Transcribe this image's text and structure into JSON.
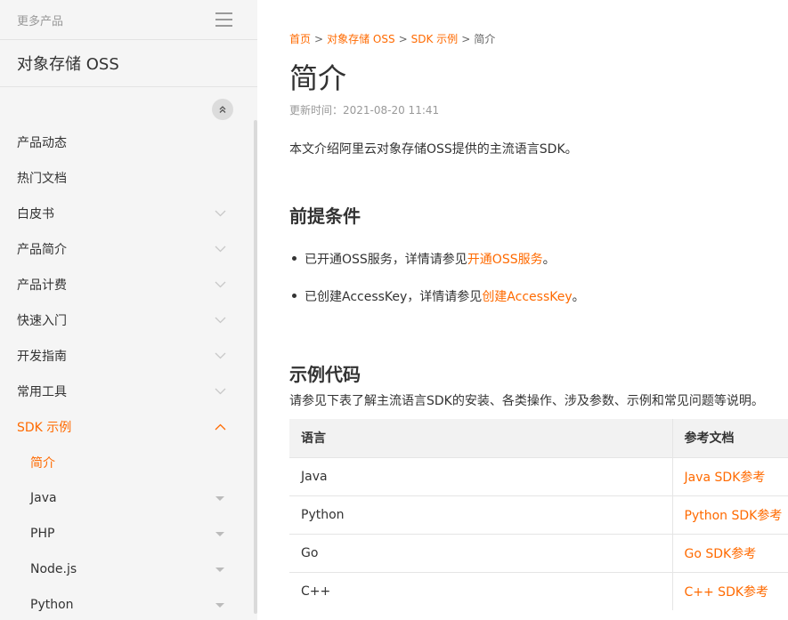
{
  "sidebar": {
    "more_products": "更多产品",
    "product_title": "对象存储 OSS",
    "items": [
      {
        "label": "产品动态",
        "arrow": "none"
      },
      {
        "label": "热门文档",
        "arrow": "none"
      },
      {
        "label": "白皮书",
        "arrow": "down"
      },
      {
        "label": "产品简介",
        "arrow": "down"
      },
      {
        "label": "产品计费",
        "arrow": "down"
      },
      {
        "label": "快速入门",
        "arrow": "down"
      },
      {
        "label": "开发指南",
        "arrow": "down"
      },
      {
        "label": "常用工具",
        "arrow": "down"
      },
      {
        "label": "SDK 示例",
        "arrow": "up",
        "state": "active-section"
      },
      {
        "label": "简介",
        "arrow": "none",
        "sub": true,
        "state": "active-leaf"
      },
      {
        "label": "Java",
        "arrow": "tri",
        "sub": true
      },
      {
        "label": "PHP",
        "arrow": "tri",
        "sub": true
      },
      {
        "label": "Node.js",
        "arrow": "tri",
        "sub": true
      },
      {
        "label": "Python",
        "arrow": "tri",
        "sub": true
      }
    ]
  },
  "breadcrumb": {
    "items": [
      "首页",
      "对象存储 OSS",
      "SDK 示例"
    ],
    "separator": ">",
    "current": "简介"
  },
  "page": {
    "title": "简介",
    "updated": "更新时间：2021-08-20 11:41",
    "intro": "本文介绍阿里云对象存储OSS提供的主流语言SDK。",
    "prereq_heading": "前提条件",
    "prereq": [
      {
        "before": "已开通OSS服务，详情请参见",
        "link": "开通OSS服务",
        "after": "。"
      },
      {
        "before": "已创建AccessKey，详情请参见",
        "link": "创建AccessKey",
        "after": "。"
      }
    ],
    "example_heading": "示例代码",
    "example_desc": "请参见下表了解主流语言SDK的安装、各类操作、涉及参数、示例和常见问题等说明。"
  },
  "table": {
    "headers": [
      "语言",
      "参考文档"
    ],
    "rows": [
      [
        "Java",
        "Java SDK参考"
      ],
      [
        "Python",
        "Python SDK参考"
      ],
      [
        "Go",
        "Go SDK参考"
      ],
      [
        "C++",
        "C++ SDK参考"
      ]
    ]
  },
  "colors": {
    "accent": "#ff6a00",
    "sidebar_bg": "#f5f5f5",
    "table_header_bg": "#f2f2f2"
  }
}
